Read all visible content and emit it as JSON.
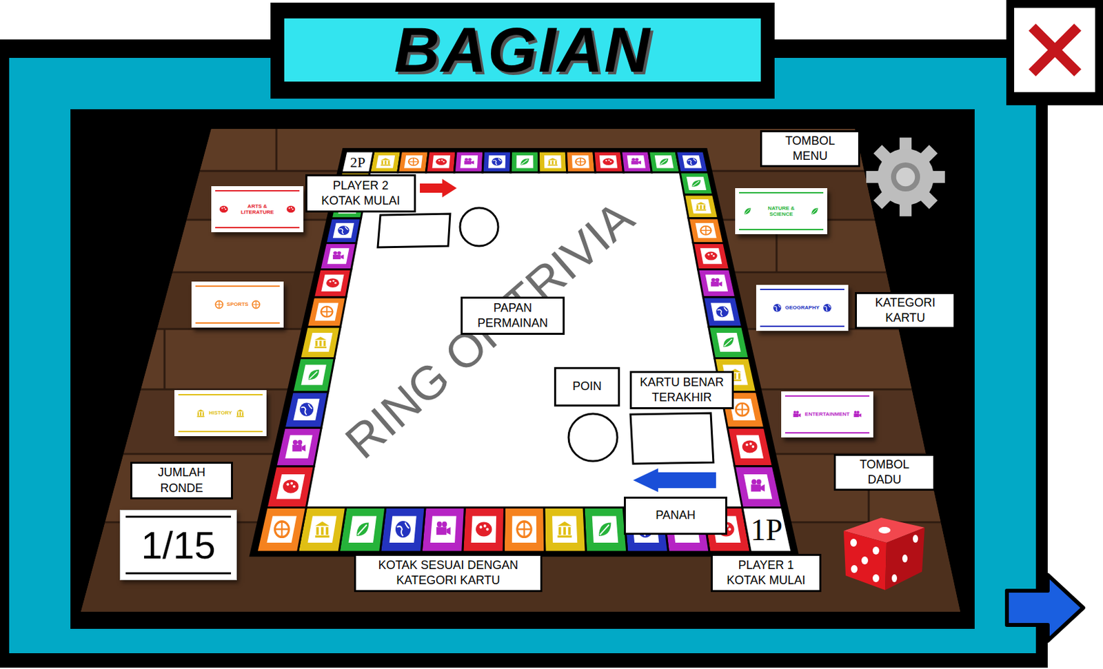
{
  "title": "BAGIAN",
  "labels": {
    "menu_button": [
      "TOMBOL",
      "MENU"
    ],
    "player2_start": [
      "PLAYER 2",
      "KOTAK MULAI"
    ],
    "board": [
      "PAPAN",
      "PERMAINAN"
    ],
    "card_category": [
      "KATEGORI",
      "KARTU"
    ],
    "points": [
      "POIN"
    ],
    "last_correct_card": [
      "KARTU BENAR",
      "TERAKHIR"
    ],
    "dice_button": [
      "TOMBOL",
      "DADU"
    ],
    "round_count": [
      "JUMLAH",
      "RONDE"
    ],
    "arrow": [
      "PANAH"
    ],
    "category_square": [
      "KOTAK SESUAI DENGAN",
      "KATEGORI KARTU"
    ],
    "player1_start": [
      "PLAYER 1",
      "KOTAK MULAI"
    ]
  },
  "round": "1/15",
  "decks": [
    {
      "kind": "arts",
      "label": "ARTS & LITERATURE",
      "color": "#e3202a"
    },
    {
      "kind": "sports",
      "label": "SPORTS",
      "color": "#f5821f"
    },
    {
      "kind": "history",
      "label": "HISTORY",
      "color": "#e0bf14"
    },
    {
      "kind": "nature",
      "label": "NATURE & SCIENCE",
      "color": "#26b33a"
    },
    {
      "kind": "geography",
      "label": "GEOGRAPHY",
      "color": "#2434c0"
    },
    {
      "kind": "entertainment",
      "label": "ENTERTAINMENT",
      "color": "#b624c4"
    }
  ],
  "board": {
    "title": "RING OF TRIVIA",
    "player2_corner": "2P",
    "player1_corner": "1P",
    "squares": [
      "history",
      "sports",
      "arts",
      "entertainment",
      "geography",
      "nature",
      "history",
      "sports",
      "arts",
      "entertainment",
      "nature",
      "geography",
      "nature",
      "history",
      "sports",
      "arts",
      "entertainment",
      "geography",
      "nature",
      "history",
      "sports",
      "arts",
      "entertainment",
      "arts",
      "entertainment",
      "geography",
      "nature",
      "history",
      "sports",
      "arts",
      "entertainment",
      "geography",
      "nature",
      "history",
      "sports",
      "arts",
      "entertainment",
      "geography",
      "nature",
      "history",
      "sports",
      "arts",
      "entertainment",
      "geography",
      "nature",
      "history"
    ]
  }
}
